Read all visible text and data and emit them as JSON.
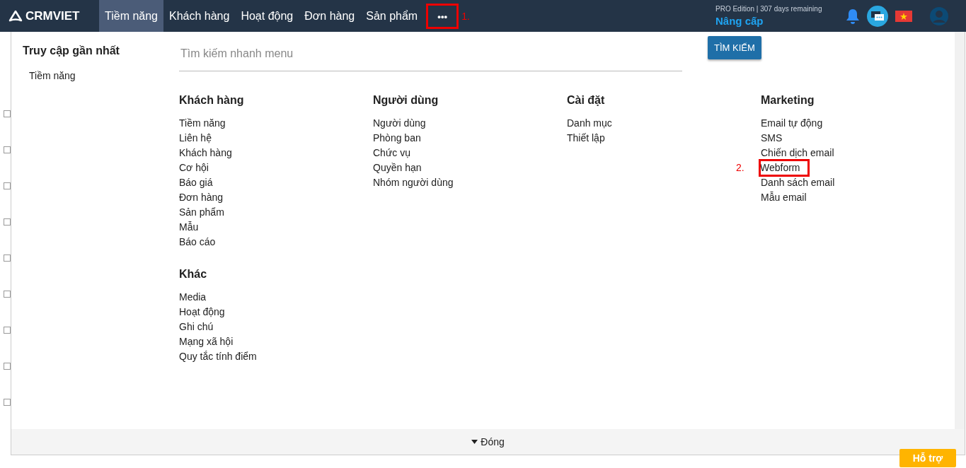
{
  "navbar": {
    "logo": "CRMVIET",
    "tabs": [
      {
        "label": "Tiềm năng",
        "selected": true
      },
      {
        "label": "Khách hàng",
        "selected": false
      },
      {
        "label": "Hoạt động",
        "selected": false
      },
      {
        "label": "Đơn hàng",
        "selected": false
      },
      {
        "label": "Sản phẩm",
        "selected": false
      }
    ],
    "more": {
      "label": "•••",
      "highlighted": true,
      "annotation": "1."
    },
    "edition": "PRO Edition | 307 days remaining",
    "upgrade": "Nâng cấp"
  },
  "background_rows": [
    {
      "checked": false
    },
    {
      "checked": false
    },
    {
      "checked": false
    },
    {
      "checked": false
    },
    {
      "checked": false
    },
    {
      "checked": false
    },
    {
      "checked": false
    },
    {
      "checked": false
    },
    {
      "checked": false
    }
  ],
  "recent": {
    "title": "Truy cập gần nhất",
    "items": [
      "Tiềm năng"
    ]
  },
  "search": {
    "placeholder": "Tìm kiếm nhanh menu",
    "button": "TÌM KIẾM"
  },
  "groups": [
    {
      "title": "Khách hàng",
      "items": [
        {
          "label": "Tiềm năng",
          "highlighted": false
        },
        {
          "label": "Liên hệ",
          "highlighted": false
        },
        {
          "label": "Khách hàng",
          "highlighted": false
        },
        {
          "label": "Cơ hội",
          "highlighted": false
        },
        {
          "label": "Báo giá",
          "highlighted": false
        },
        {
          "label": "Đơn hàng",
          "highlighted": false
        },
        {
          "label": "Sản phẩm",
          "highlighted": false
        },
        {
          "label": "Mẫu",
          "highlighted": false
        },
        {
          "label": "Báo cáo",
          "highlighted": false
        }
      ]
    },
    {
      "title": "Người dùng",
      "items": [
        {
          "label": "Người dùng",
          "highlighted": false
        },
        {
          "label": "Phòng ban",
          "highlighted": false
        },
        {
          "label": "Chức vụ",
          "highlighted": false
        },
        {
          "label": "Quyền hạn",
          "highlighted": false
        },
        {
          "label": "Nhóm người dùng",
          "highlighted": false
        }
      ]
    },
    {
      "title": "Cài đặt",
      "items": [
        {
          "label": "Danh mục",
          "highlighted": false
        },
        {
          "label": "Thiết lập",
          "highlighted": false
        }
      ]
    },
    {
      "title": "Marketing",
      "items": [
        {
          "label": "Email tự động",
          "highlighted": false
        },
        {
          "label": "SMS",
          "highlighted": false
        },
        {
          "label": "Chiến dịch email",
          "highlighted": false
        },
        {
          "label": "Webform",
          "highlighted": true,
          "annotation": "2."
        },
        {
          "label": "Danh sách email",
          "highlighted": false
        },
        {
          "label": "Mẫu email",
          "highlighted": false
        }
      ]
    },
    {
      "title": "Khác",
      "items": [
        {
          "label": "Media",
          "highlighted": false
        },
        {
          "label": "Hoạt động",
          "highlighted": false
        },
        {
          "label": "Ghi chú",
          "highlighted": false
        },
        {
          "label": "Mạng xã hội",
          "highlighted": false
        },
        {
          "label": "Quy tắc tính điểm",
          "highlighted": false
        }
      ]
    }
  ],
  "close": "Đóng",
  "support": "Hỗ trợ"
}
